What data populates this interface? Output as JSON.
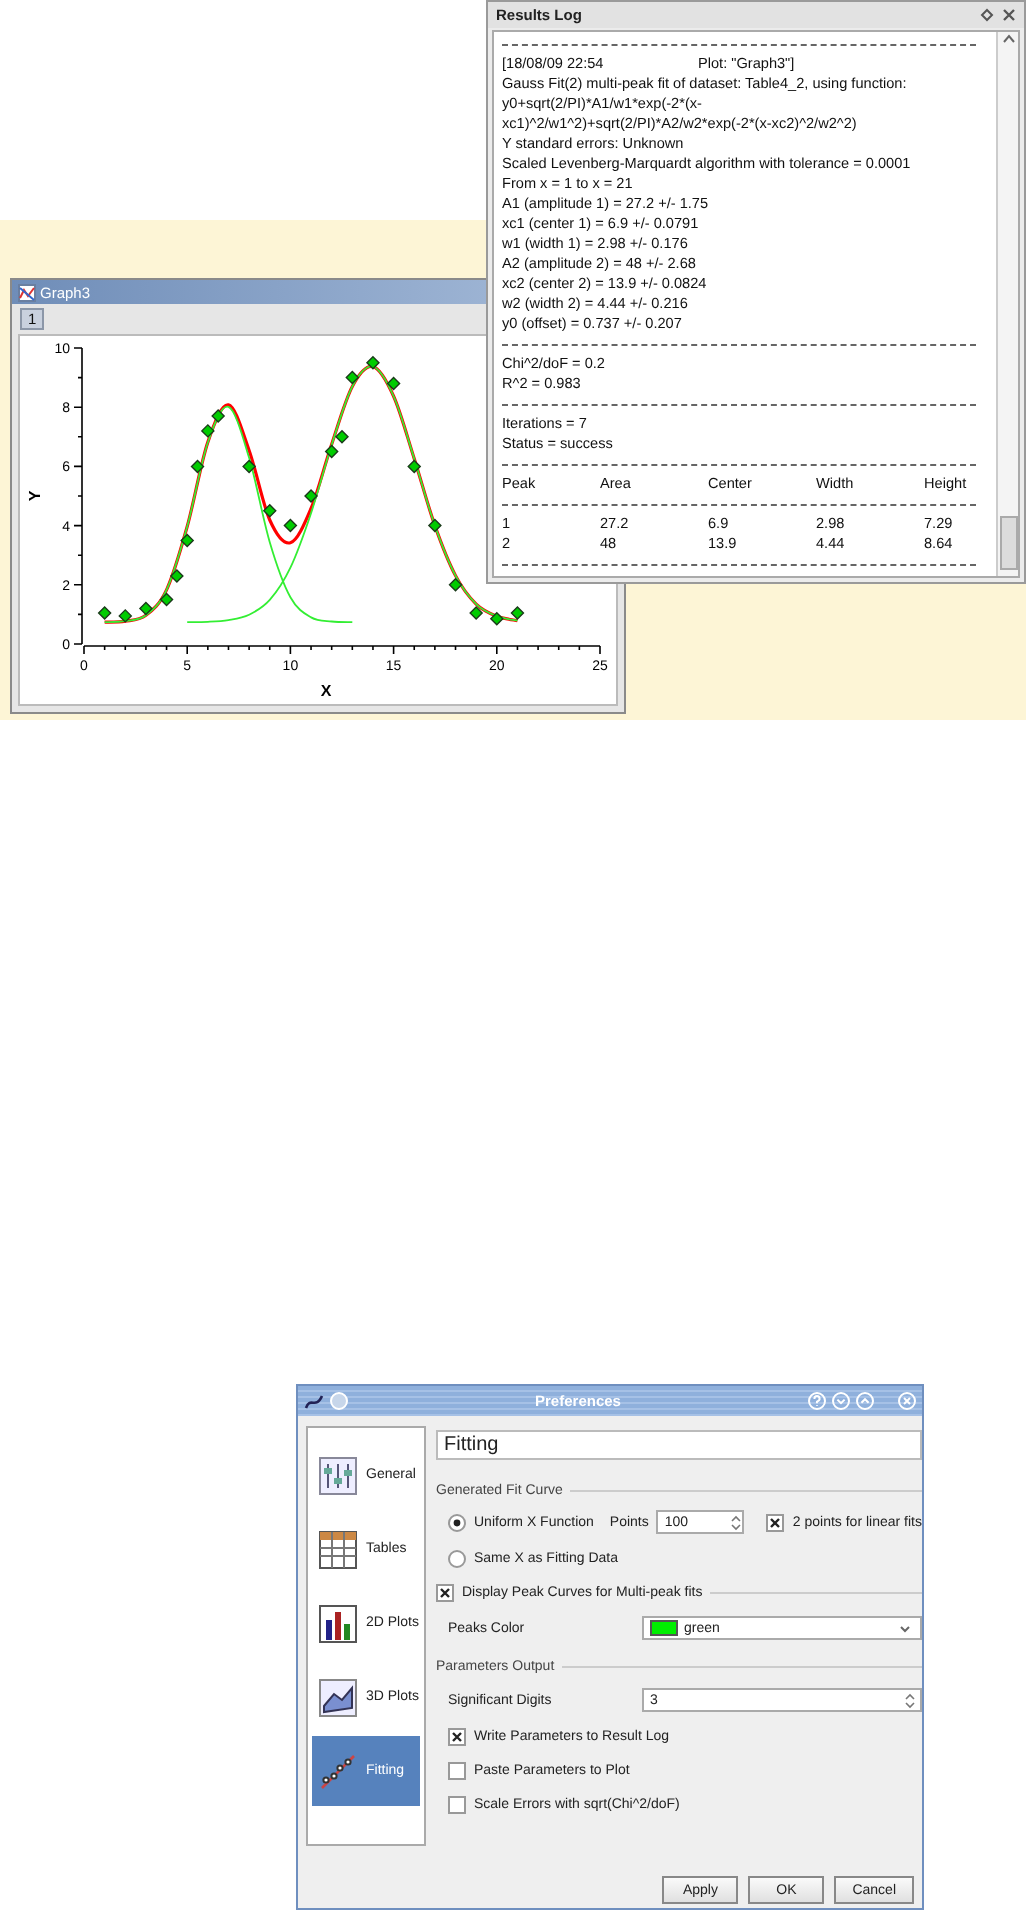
{
  "results_log": {
    "title": "Results Log",
    "lines": [
      {
        "kind": "rule"
      },
      {
        "kind": "pair",
        "cells": [
          "[18/08/09 22:54",
          "Plot: \"Graph3\"]"
        ]
      },
      {
        "kind": "text",
        "text": "Gauss Fit(2) multi-peak fit of dataset: Table4_2, using function:"
      },
      {
        "kind": "text",
        "text": "y0+sqrt(2/PI)*A1/w1*exp(-2*(x-"
      },
      {
        "kind": "text",
        "text": "xc1)^2/w1^2)+sqrt(2/PI)*A2/w2*exp(-2*(x-xc2)^2/w2^2)"
      },
      {
        "kind": "text",
        "text": "Y standard errors: Unknown"
      },
      {
        "kind": "text",
        "text": "Scaled Levenberg-Marquardt algorithm with tolerance = 0.0001"
      },
      {
        "kind": "text",
        "text": "From x = 1 to x = 21"
      },
      {
        "kind": "text",
        "text": "A1 (amplitude 1) = 27.2 +/- 1.75"
      },
      {
        "kind": "text",
        "text": "xc1 (center 1) = 6.9 +/- 0.0791"
      },
      {
        "kind": "text",
        "text": "w1 (width 1) = 2.98 +/- 0.176"
      },
      {
        "kind": "text",
        "text": "A2 (amplitude 2) = 48 +/- 2.68"
      },
      {
        "kind": "text",
        "text": "xc2 (center 2) = 13.9 +/- 0.0824"
      },
      {
        "kind": "text",
        "text": "w2 (width 2) = 4.44 +/- 0.216"
      },
      {
        "kind": "text",
        "text": "y0 (offset) = 0.737 +/- 0.207"
      },
      {
        "kind": "rule"
      },
      {
        "kind": "text",
        "text": "Chi^2/doF = 0.2"
      },
      {
        "kind": "text",
        "text": "R^2 = 0.983"
      },
      {
        "kind": "rule"
      },
      {
        "kind": "text",
        "text": "Iterations = 7"
      },
      {
        "kind": "text",
        "text": "Status = success"
      },
      {
        "kind": "rule"
      },
      {
        "kind": "row",
        "cells": [
          "Peak",
          "Area",
          "Center",
          "Width",
          "Height"
        ]
      },
      {
        "kind": "rule"
      },
      {
        "kind": "row",
        "cells": [
          "1",
          "27.2",
          "6.9",
          "2.98",
          "7.29"
        ]
      },
      {
        "kind": "row",
        "cells": [
          "2",
          "48",
          "13.9",
          "4.44",
          "8.64"
        ]
      },
      {
        "kind": "rule"
      }
    ]
  },
  "graph_window": {
    "title": "Graph3",
    "layer_tab": "1",
    "chart_data": {
      "type": "scatter",
      "xlabel": "X",
      "ylabel": "Y",
      "xlim": [
        0,
        25
      ],
      "ylim": [
        0,
        10
      ],
      "xticks": [
        0,
        5,
        10,
        15,
        20,
        25
      ],
      "yticks": [
        0,
        2,
        4,
        6,
        8,
        10
      ],
      "series": [
        {
          "type": "line",
          "color": "#ff0000",
          "x": [
            1,
            2,
            3,
            4,
            5,
            6,
            7,
            8,
            9,
            10,
            11,
            12,
            13,
            14,
            15,
            16,
            17,
            18,
            19,
            20,
            21
          ],
          "values": [
            0.74,
            0.77,
            0.97,
            1.83,
            3.97,
            6.82,
            8.08,
            6.54,
            4.19,
            3.42,
            4.58,
            6.75,
            8.7,
            9.37,
            8.37,
            6.26,
            4.0,
            2.31,
            1.35,
            0.94,
            0.79
          ]
        },
        {
          "type": "line",
          "color": "#33ee33",
          "x": [
            1,
            2,
            3,
            4,
            5,
            6,
            7,
            8,
            9,
            10,
            11,
            12,
            13
          ],
          "values": [
            0.74,
            0.77,
            0.97,
            1.83,
            3.97,
            6.81,
            8.01,
            6.29,
            3.44,
            1.58,
            0.9,
            0.76,
            0.74
          ]
        },
        {
          "type": "line",
          "color": "#33ee33",
          "x": [
            5,
            6,
            7,
            8,
            9,
            10,
            11,
            12,
            13,
            14,
            15,
            16,
            17,
            18,
            19,
            20,
            21
          ],
          "values": [
            0.74,
            0.75,
            0.81,
            0.99,
            1.49,
            2.58,
            4.42,
            6.73,
            8.7,
            9.37,
            8.37,
            6.26,
            4.0,
            2.31,
            1.35,
            0.94,
            0.79
          ]
        },
        {
          "color": "#00cc00",
          "x": [
            1,
            2,
            3,
            4,
            4.5,
            5,
            5.5,
            6,
            6.5,
            8,
            9,
            10,
            11,
            12,
            12.5,
            13,
            14,
            15,
            16,
            17,
            18,
            19,
            20,
            21
          ],
          "values": [
            1.05,
            0.95,
            1.2,
            1.5,
            2.3,
            3.5,
            6.0,
            7.2,
            7.7,
            6.0,
            4.5,
            4.0,
            5.0,
            6.5,
            7.0,
            9.0,
            9.5,
            8.8,
            6.0,
            4.0,
            2.0,
            1.05,
            0.85,
            1.05
          ]
        }
      ]
    }
  },
  "preferences": {
    "title": "Preferences",
    "sidebar": [
      {
        "label": "General",
        "selected": false
      },
      {
        "label": "Tables",
        "selected": false
      },
      {
        "label": "2D Plots",
        "selected": false
      },
      {
        "label": "3D Plots",
        "selected": false
      },
      {
        "label": "Fitting",
        "selected": true
      }
    ],
    "page_title": "Fitting",
    "generated_fit_curve": {
      "title": "Generated Fit Curve",
      "options": [
        {
          "label": "Uniform X Function",
          "selected": true
        },
        {
          "label": "Same X as Fitting Data",
          "selected": false
        }
      ],
      "points_label": "Points",
      "points_value": "100",
      "linear_fits": {
        "label": "2 points for linear fits",
        "checked": true
      }
    },
    "display_peak_curves": {
      "label": "Display Peak Curves for Multi-peak fits",
      "checked": true
    },
    "peaks_color": {
      "label": "Peaks Color",
      "value": "green",
      "color": "#00ee00"
    },
    "parameters_output": {
      "title": "Parameters Output",
      "significant_digits_label": "Significant Digits",
      "significant_digits_value": "3",
      "options": [
        {
          "label": "Write Parameters to Result Log",
          "checked": true
        },
        {
          "label": "Paste Parameters to Plot",
          "checked": false
        },
        {
          "label": "Scale Errors with sqrt(Chi^2/doF)",
          "checked": false
        }
      ]
    },
    "buttons": [
      "Apply",
      "OK",
      "Cancel"
    ]
  }
}
